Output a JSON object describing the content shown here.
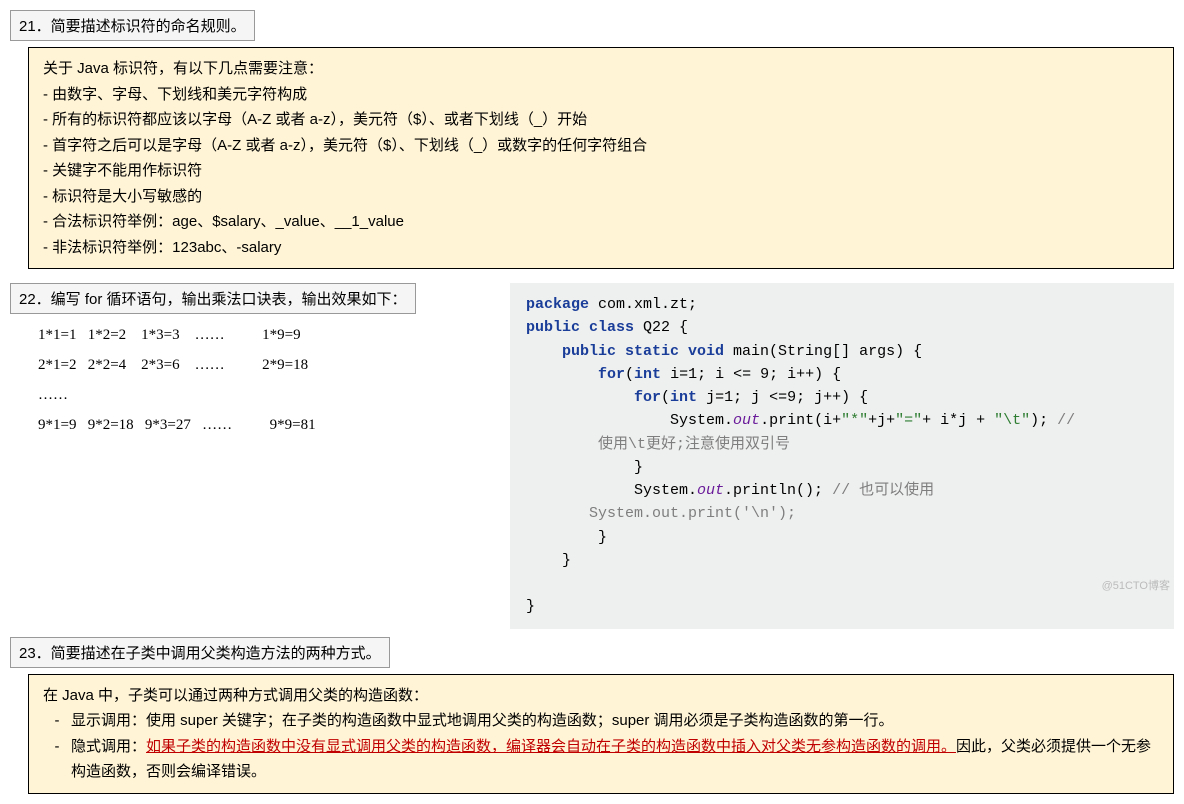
{
  "q21": {
    "header": "21．简要描述标识符的命名规则。",
    "intro": "关于 Java 标识符，有以下几点需要注意：",
    "bullets": [
      "- 由数字、字母、下划线和美元字符构成",
      "- 所有的标识符都应该以字母（A-Z 或者 a-z），美元符（$）、或者下划线（_）开始",
      "- 首字符之后可以是字母（A-Z 或者 a-z），美元符（$）、下划线（_）或数字的任何字符组合",
      "- 关键字不能用作标识符",
      "- 标识符是大小写敏感的",
      "- 合法标识符举例：age、$salary、_value、__1_value",
      "- 非法标识符举例：123abc、-salary"
    ]
  },
  "q22": {
    "header": "22．编写 for 循环语句，输出乘法口诀表，输出效果如下：",
    "rows": [
      "1*1=1   1*2=2    1*3=3    ……          1*9=9",
      "2*1=2   2*2=4    2*3=6    ……          2*9=18",
      "……",
      "9*1=9   9*2=18   9*3=27   ……          9*9=81"
    ],
    "code": {
      "l1a": "package",
      "l1b": " com.xml.zt;",
      "l2a": "public class",
      "l2b": " Q22 {",
      "l3a": "    public static void",
      "l3b": " main(String[] args) {",
      "l4a": "        for",
      "l4b": "(",
      "l4c": "int",
      "l4d": " i=1; i <= 9; i++) {",
      "l5a": "            for",
      "l5b": "(",
      "l5c": "int",
      "l5d": " j=1; j <=9; j++) {",
      "l6a": "                System.",
      "l6b": "out",
      "l6c": ".print(i+",
      "l6d": "\"*\"",
      "l6e": "+j+",
      "l6f": "\"=\"",
      "l6g": "+ i*j + ",
      "l6h": "\"\\t\"",
      "l6i": "); ",
      "l6j": "//",
      "l6cmt": "使用\\t更好;注意使用双引号",
      "l7": "            }",
      "l8a": "            System.",
      "l8b": "out",
      "l8c": ".println(); ",
      "l8d": "// 也可以使用",
      "l8e": "System.out.print('\\n');",
      "l9": "        }",
      "l10": "    }",
      "l11": "",
      "l12": "}"
    }
  },
  "q23": {
    "header": "23．简要描述在子类中调用父类构造方法的两种方式。",
    "intro": "在 Java 中，子类可以通过两种方式调用父类的构造函数：",
    "b1": "显示调用：使用 super 关键字；在子类的构造函数中显式地调用父类的构造函数；super 调用必须是子类构造函数的第一行。",
    "b2pre": "隐式调用：",
    "b2red": "如果子类的构造函数中没有显式调用父类的构造函数，编译器会自动在子类的构造函数中插入对父类无参构造函数的调用。",
    "b2post": "因此，父类必须提供一个无参构造函数，否则会编译错误。"
  },
  "watermark": "@51CTO博客"
}
